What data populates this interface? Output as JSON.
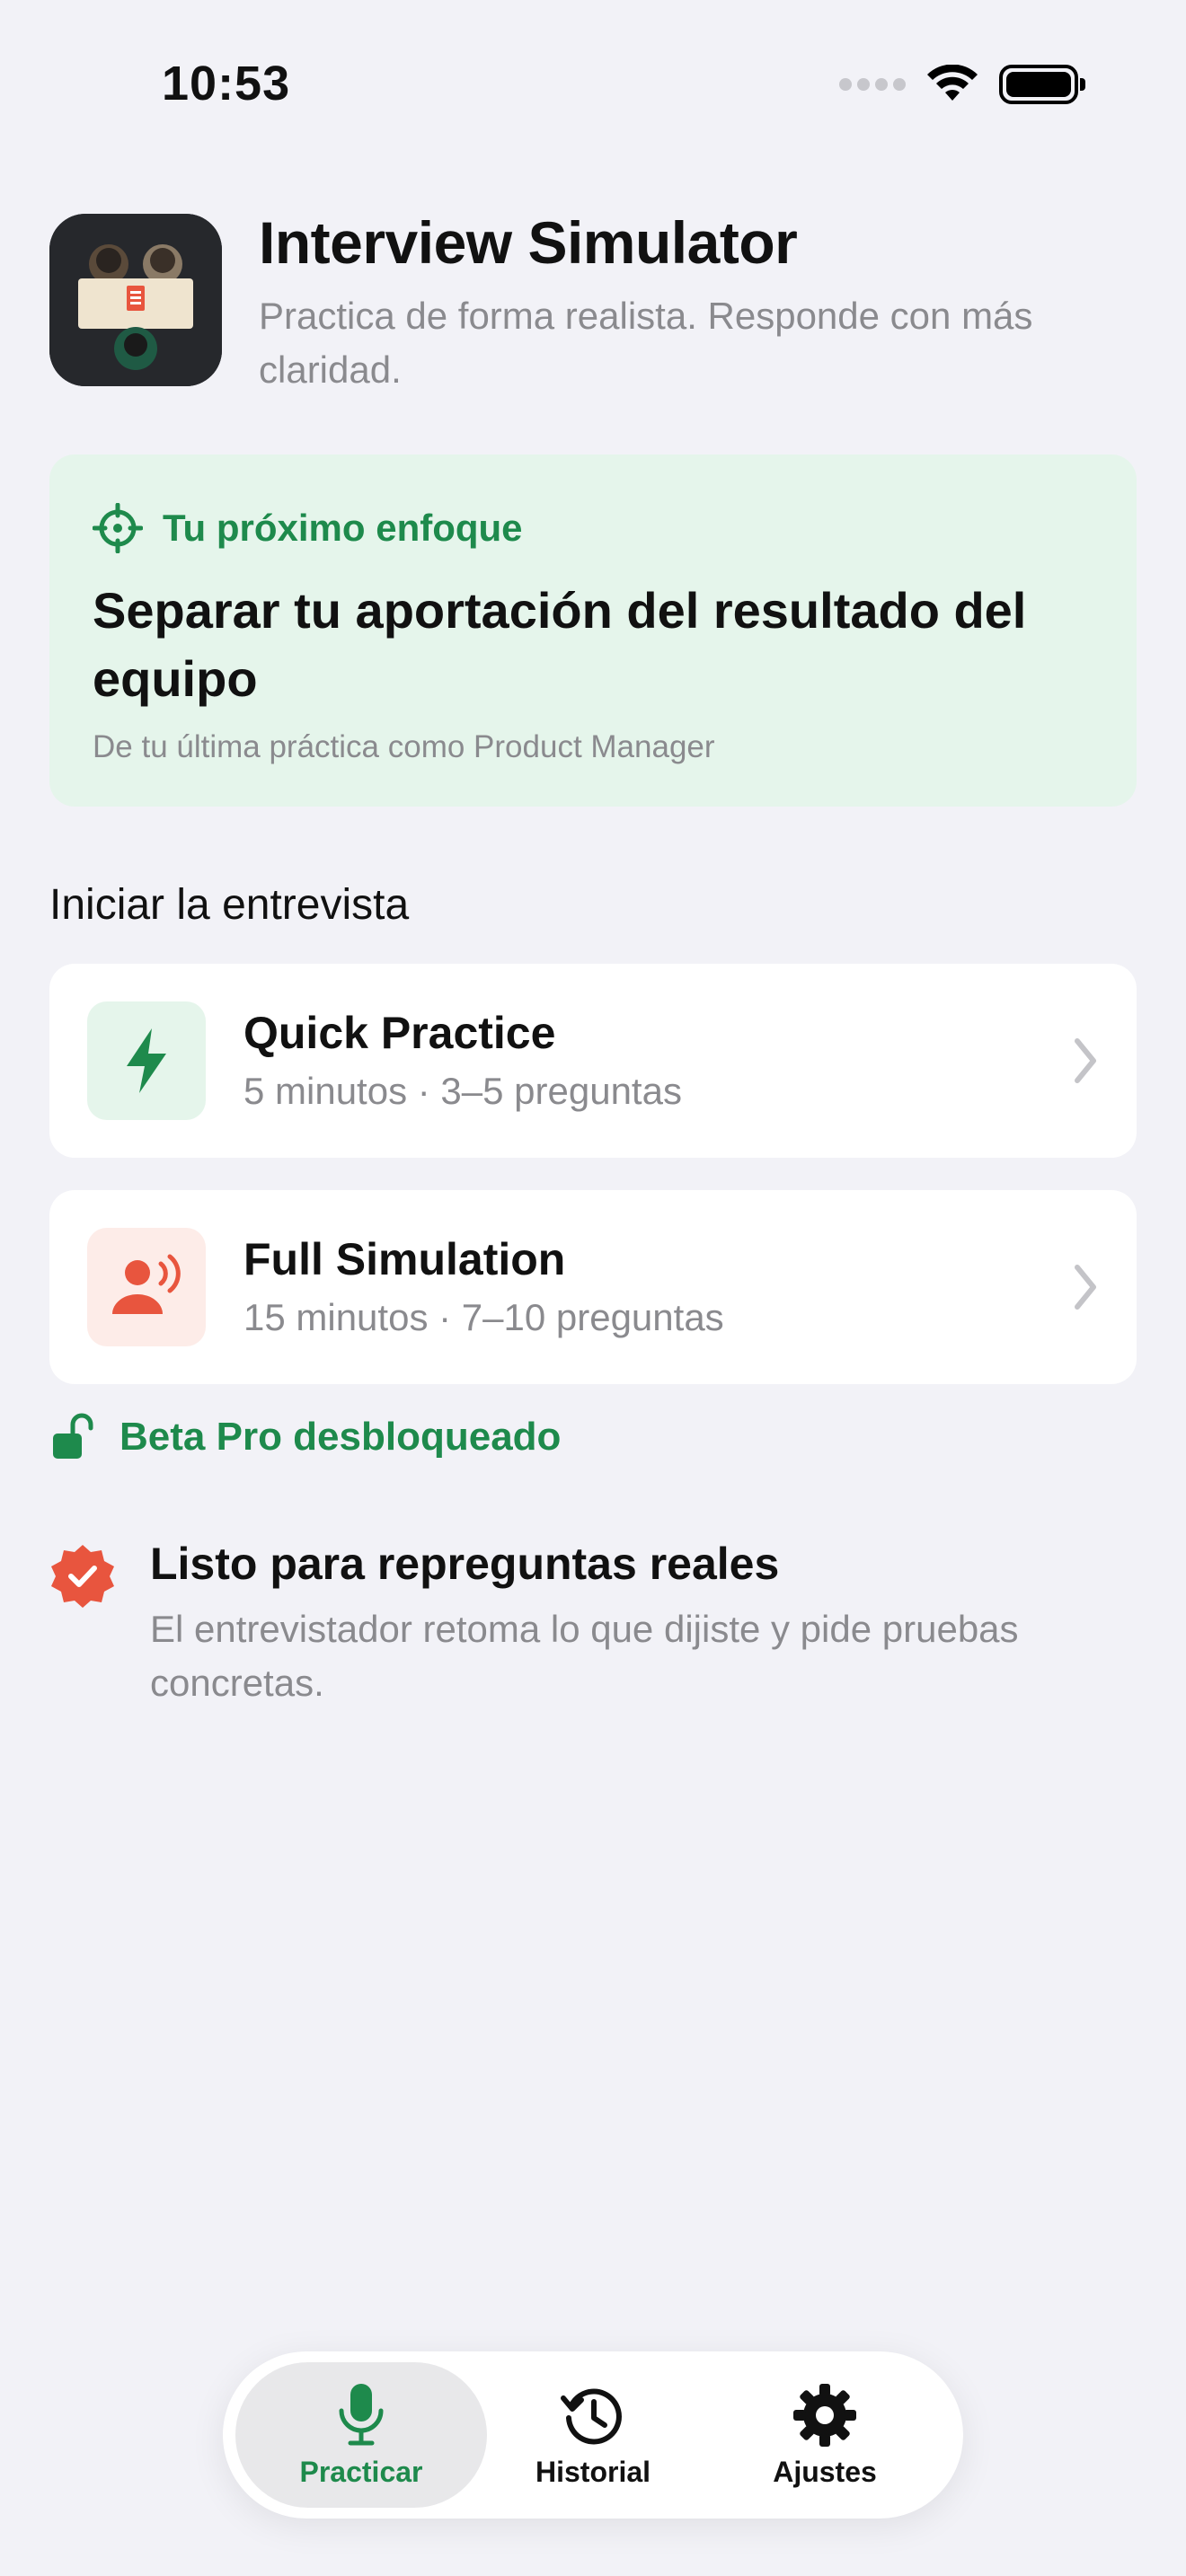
{
  "status_bar": {
    "time": "10:53"
  },
  "header": {
    "title": "Interview Simulator",
    "subtitle": "Practica de forma realista. Responde con más claridad."
  },
  "focus": {
    "label": "Tu próximo enfoque",
    "title": "Separar tu aportación del resultado del equipo",
    "source": "De tu última práctica como Product Manager"
  },
  "section": {
    "title": "Iniciar la entrevista"
  },
  "options": [
    {
      "title": "Quick Practice",
      "subtitle": "5 minutos · 3–5 preguntas",
      "icon": "bolt-icon"
    },
    {
      "title": "Full Simulation",
      "subtitle": "15 minutos · 7–10 preguntas",
      "icon": "person-voice-icon"
    }
  ],
  "beta": {
    "label": "Beta Pro desbloqueado"
  },
  "ready": {
    "title": "Listo para repreguntas reales",
    "description": "El entrevistador retoma lo que dijiste y pide pruebas concretas."
  },
  "tabs": [
    {
      "label": "Practicar",
      "icon": "mic-icon",
      "active": true
    },
    {
      "label": "Historial",
      "icon": "history-icon",
      "active": false
    },
    {
      "label": "Ajustes",
      "icon": "gear-icon",
      "active": false
    }
  ],
  "colors": {
    "accent_green": "#1e8a4c",
    "focus_bg": "#e5f5eb",
    "accent_red": "#e8553e",
    "background": "#f2f2f7"
  }
}
